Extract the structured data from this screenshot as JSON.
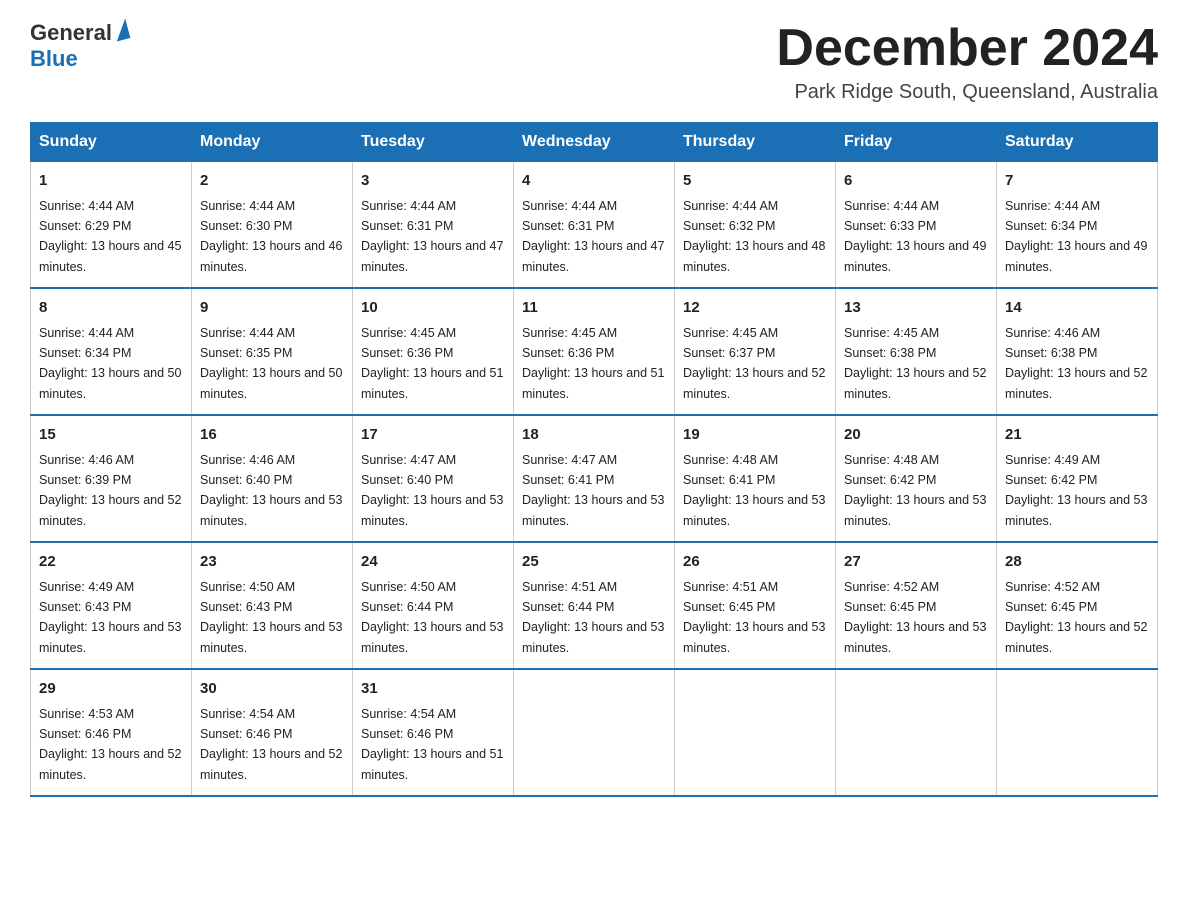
{
  "header": {
    "logo_general": "General",
    "logo_blue": "Blue",
    "month_title": "December 2024",
    "location": "Park Ridge South, Queensland, Australia"
  },
  "days_of_week": [
    "Sunday",
    "Monday",
    "Tuesday",
    "Wednesday",
    "Thursday",
    "Friday",
    "Saturday"
  ],
  "weeks": [
    [
      {
        "day": "1",
        "sunrise": "4:44 AM",
        "sunset": "6:29 PM",
        "daylight": "13 hours and 45 minutes."
      },
      {
        "day": "2",
        "sunrise": "4:44 AM",
        "sunset": "6:30 PM",
        "daylight": "13 hours and 46 minutes."
      },
      {
        "day": "3",
        "sunrise": "4:44 AM",
        "sunset": "6:31 PM",
        "daylight": "13 hours and 47 minutes."
      },
      {
        "day": "4",
        "sunrise": "4:44 AM",
        "sunset": "6:31 PM",
        "daylight": "13 hours and 47 minutes."
      },
      {
        "day": "5",
        "sunrise": "4:44 AM",
        "sunset": "6:32 PM",
        "daylight": "13 hours and 48 minutes."
      },
      {
        "day": "6",
        "sunrise": "4:44 AM",
        "sunset": "6:33 PM",
        "daylight": "13 hours and 49 minutes."
      },
      {
        "day": "7",
        "sunrise": "4:44 AM",
        "sunset": "6:34 PM",
        "daylight": "13 hours and 49 minutes."
      }
    ],
    [
      {
        "day": "8",
        "sunrise": "4:44 AM",
        "sunset": "6:34 PM",
        "daylight": "13 hours and 50 minutes."
      },
      {
        "day": "9",
        "sunrise": "4:44 AM",
        "sunset": "6:35 PM",
        "daylight": "13 hours and 50 minutes."
      },
      {
        "day": "10",
        "sunrise": "4:45 AM",
        "sunset": "6:36 PM",
        "daylight": "13 hours and 51 minutes."
      },
      {
        "day": "11",
        "sunrise": "4:45 AM",
        "sunset": "6:36 PM",
        "daylight": "13 hours and 51 minutes."
      },
      {
        "day": "12",
        "sunrise": "4:45 AM",
        "sunset": "6:37 PM",
        "daylight": "13 hours and 52 minutes."
      },
      {
        "day": "13",
        "sunrise": "4:45 AM",
        "sunset": "6:38 PM",
        "daylight": "13 hours and 52 minutes."
      },
      {
        "day": "14",
        "sunrise": "4:46 AM",
        "sunset": "6:38 PM",
        "daylight": "13 hours and 52 minutes."
      }
    ],
    [
      {
        "day": "15",
        "sunrise": "4:46 AM",
        "sunset": "6:39 PM",
        "daylight": "13 hours and 52 minutes."
      },
      {
        "day": "16",
        "sunrise": "4:46 AM",
        "sunset": "6:40 PM",
        "daylight": "13 hours and 53 minutes."
      },
      {
        "day": "17",
        "sunrise": "4:47 AM",
        "sunset": "6:40 PM",
        "daylight": "13 hours and 53 minutes."
      },
      {
        "day": "18",
        "sunrise": "4:47 AM",
        "sunset": "6:41 PM",
        "daylight": "13 hours and 53 minutes."
      },
      {
        "day": "19",
        "sunrise": "4:48 AM",
        "sunset": "6:41 PM",
        "daylight": "13 hours and 53 minutes."
      },
      {
        "day": "20",
        "sunrise": "4:48 AM",
        "sunset": "6:42 PM",
        "daylight": "13 hours and 53 minutes."
      },
      {
        "day": "21",
        "sunrise": "4:49 AM",
        "sunset": "6:42 PM",
        "daylight": "13 hours and 53 minutes."
      }
    ],
    [
      {
        "day": "22",
        "sunrise": "4:49 AM",
        "sunset": "6:43 PM",
        "daylight": "13 hours and 53 minutes."
      },
      {
        "day": "23",
        "sunrise": "4:50 AM",
        "sunset": "6:43 PM",
        "daylight": "13 hours and 53 minutes."
      },
      {
        "day": "24",
        "sunrise": "4:50 AM",
        "sunset": "6:44 PM",
        "daylight": "13 hours and 53 minutes."
      },
      {
        "day": "25",
        "sunrise": "4:51 AM",
        "sunset": "6:44 PM",
        "daylight": "13 hours and 53 minutes."
      },
      {
        "day": "26",
        "sunrise": "4:51 AM",
        "sunset": "6:45 PM",
        "daylight": "13 hours and 53 minutes."
      },
      {
        "day": "27",
        "sunrise": "4:52 AM",
        "sunset": "6:45 PM",
        "daylight": "13 hours and 53 minutes."
      },
      {
        "day": "28",
        "sunrise": "4:52 AM",
        "sunset": "6:45 PM",
        "daylight": "13 hours and 52 minutes."
      }
    ],
    [
      {
        "day": "29",
        "sunrise": "4:53 AM",
        "sunset": "6:46 PM",
        "daylight": "13 hours and 52 minutes."
      },
      {
        "day": "30",
        "sunrise": "4:54 AM",
        "sunset": "6:46 PM",
        "daylight": "13 hours and 52 minutes."
      },
      {
        "day": "31",
        "sunrise": "4:54 AM",
        "sunset": "6:46 PM",
        "daylight": "13 hours and 51 minutes."
      },
      null,
      null,
      null,
      null
    ]
  ]
}
